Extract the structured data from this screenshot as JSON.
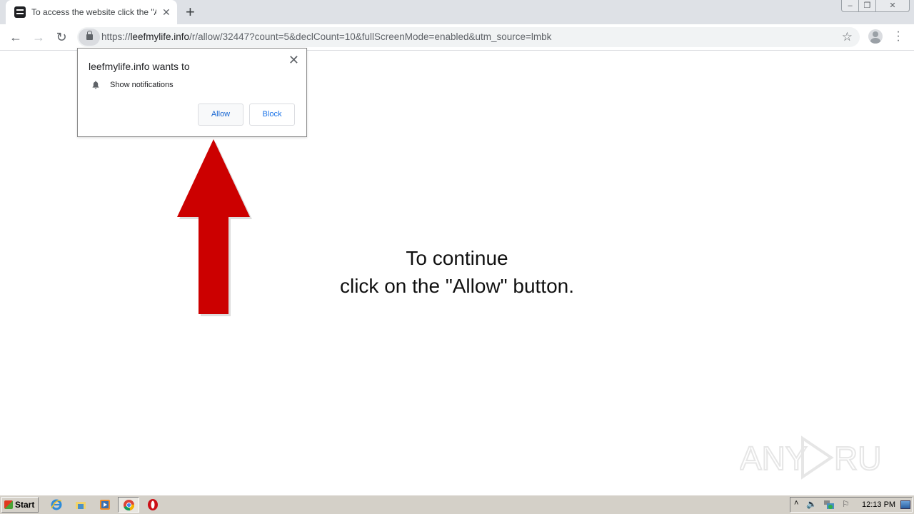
{
  "browser": {
    "tab_title": "To access the website click the \"Allow\" button",
    "new_tab_label": "+",
    "url_scheme": "https://",
    "url_host": "leefmylife.info",
    "url_path": "/r/allow/32447?count=5&declCount=10&fullScreenMode=enabled&utm_source=lmbk",
    "window_controls": {
      "minimize": "–",
      "restore": "❐",
      "close": "✕"
    }
  },
  "permission_prompt": {
    "title": "leefmylife.info wants to",
    "permission": "Show notifications",
    "allow_label": "Allow",
    "block_label": "Block",
    "close_label": "✕"
  },
  "page": {
    "line1": "To continue",
    "line2": "click on the \"Allow\" button.",
    "arrow_color": "#cc0000",
    "watermark": "ANY RUN"
  },
  "taskbar": {
    "start_label": "Start",
    "pinned": [
      "internet-explorer",
      "file-explorer",
      "media-player",
      "chrome",
      "opera"
    ],
    "clock": "12:13 PM"
  }
}
